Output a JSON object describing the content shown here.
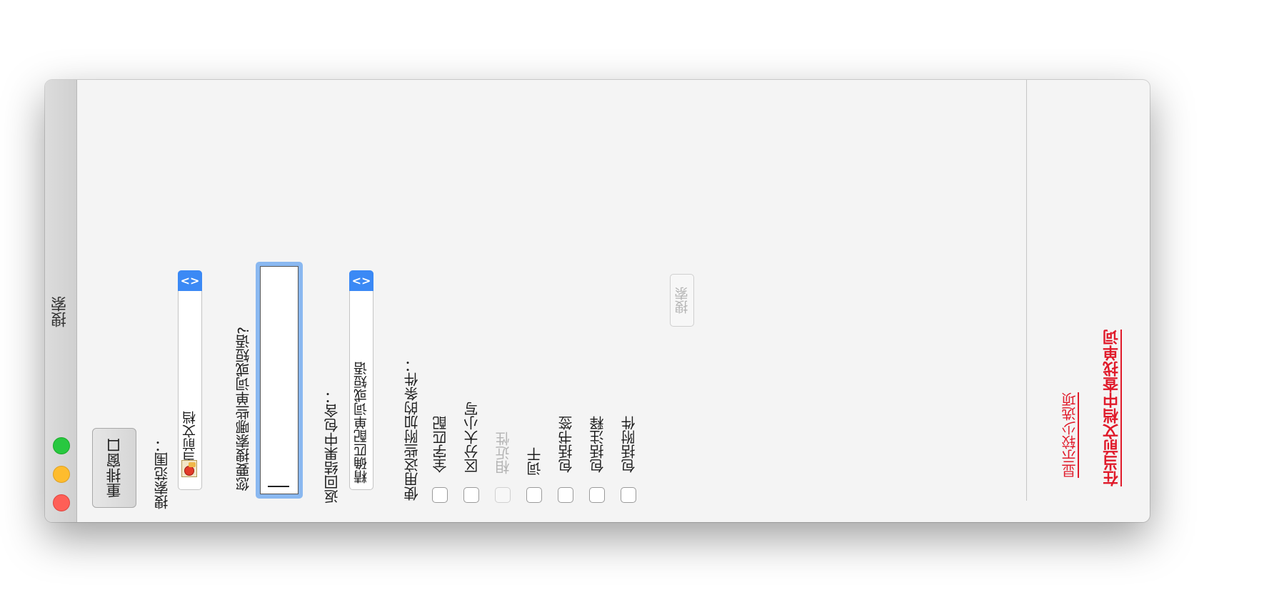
{
  "window": {
    "title": "搜索",
    "rearrange_button": "重排窗口"
  },
  "scope": {
    "label": "搜索范围：",
    "selected": "当前文档"
  },
  "query": {
    "label": "您要搜索哪些单词或短语?",
    "value": ""
  },
  "results": {
    "label": "返回结果中包含：",
    "selected": "精确匹配单词或短语"
  },
  "criteria": {
    "label": "使用这些附加的条件：",
    "items": [
      {
        "label": "全字匹配",
        "checked": false,
        "enabled": true
      },
      {
        "label": "区分大小写",
        "checked": false,
        "enabled": true
      },
      {
        "label": "相近性",
        "checked": false,
        "enabled": false
      },
      {
        "label": "词干",
        "checked": false,
        "enabled": true
      },
      {
        "label": "包括书签",
        "checked": false,
        "enabled": true
      },
      {
        "label": "包括注释",
        "checked": false,
        "enabled": true
      },
      {
        "label": "包括附件",
        "checked": false,
        "enabled": true
      }
    ]
  },
  "search_button": "搜索",
  "links": {
    "fewer_options": "显示较少选项",
    "find_in_document": "在当前文档中查找单词"
  },
  "colors": {
    "link": "#e01a2a",
    "accent": "#3b89f5"
  }
}
